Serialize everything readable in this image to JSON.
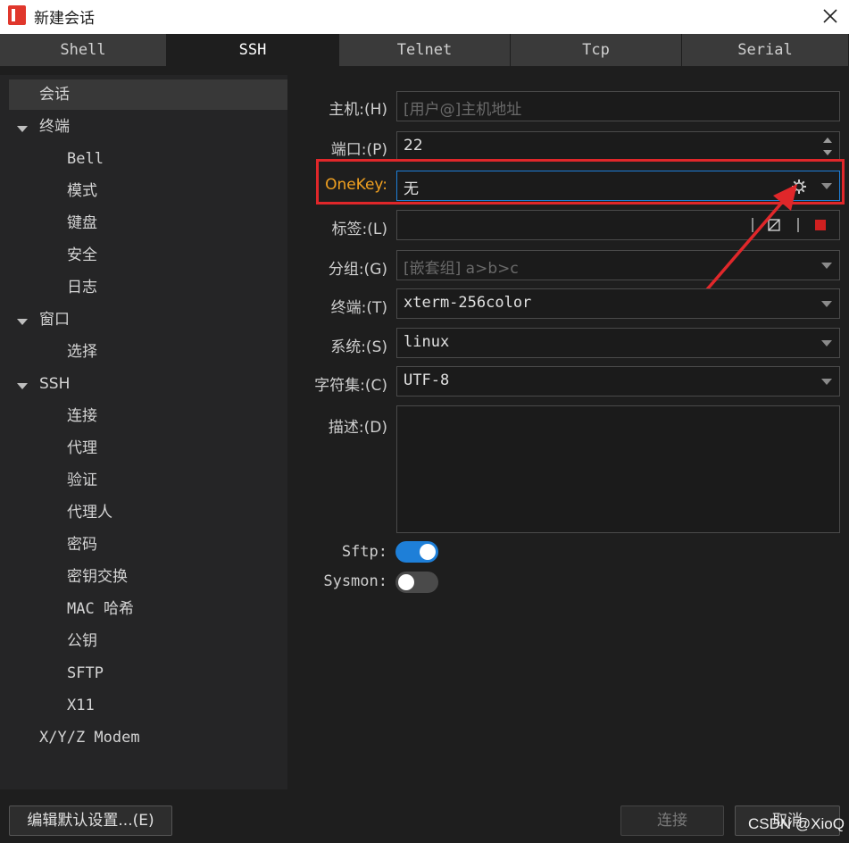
{
  "window": {
    "title": "新建会话"
  },
  "tabs": [
    {
      "label": "Shell",
      "active": false
    },
    {
      "label": "SSH",
      "active": true
    },
    {
      "label": "Telnet",
      "active": false
    },
    {
      "label": "Tcp",
      "active": false
    },
    {
      "label": "Serial",
      "active": false
    }
  ],
  "sidebar": {
    "items": [
      {
        "label": "会话",
        "selected": true
      },
      {
        "label": "终端",
        "expandable": true
      },
      {
        "label": "Bell"
      },
      {
        "label": "模式"
      },
      {
        "label": "键盘"
      },
      {
        "label": "安全"
      },
      {
        "label": "日志"
      },
      {
        "label": "窗口",
        "expandable": true
      },
      {
        "label": "选择"
      },
      {
        "label": "SSH",
        "expandable": true
      },
      {
        "label": "连接"
      },
      {
        "label": "代理"
      },
      {
        "label": "验证"
      },
      {
        "label": "代理人"
      },
      {
        "label": "密码"
      },
      {
        "label": "密钥交换"
      },
      {
        "label": "MAC 哈希"
      },
      {
        "label": "公钥"
      },
      {
        "label": "SFTP"
      },
      {
        "label": "X11"
      },
      {
        "label": "X/Y/Z Modem"
      }
    ]
  },
  "form": {
    "host": {
      "label": "主机:(H)",
      "placeholder": "[用户@]主机地址"
    },
    "port": {
      "label": "端口:(P)",
      "value": "22"
    },
    "onekey": {
      "label": "OneKey:",
      "value": "无"
    },
    "tag": {
      "label": "标签:(L)",
      "value": ""
    },
    "group": {
      "label": "分组:(G)",
      "placeholder": "[嵌套组] a>b>c"
    },
    "terminal": {
      "label": "终端:(T)",
      "value": "xterm-256color"
    },
    "system": {
      "label": "系统:(S)",
      "value": "linux"
    },
    "charset": {
      "label": "字符集:(C)",
      "value": "UTF-8"
    },
    "description": {
      "label": "描述:(D)",
      "value": ""
    },
    "sftp": {
      "label": "Sftp:",
      "on": true
    },
    "sysmon": {
      "label": "Sysmon:",
      "on": false
    }
  },
  "buttons": {
    "edit_defaults": "编辑默认设置...(E)",
    "connect": "连接",
    "cancel": "取消"
  },
  "watermark": "CSDN @XioQ",
  "colors": {
    "accent_blue": "#1e7fd8",
    "highlight_red": "#e0272a",
    "onekey_orange": "#f0a020",
    "tag_red": "#d02020"
  },
  "icons": [
    "app-logo-icon",
    "close-icon",
    "gear-icon",
    "chevron-down-icon",
    "spin-up-icon",
    "spin-down-icon",
    "clear-tag-icon",
    "color-square-icon"
  ]
}
